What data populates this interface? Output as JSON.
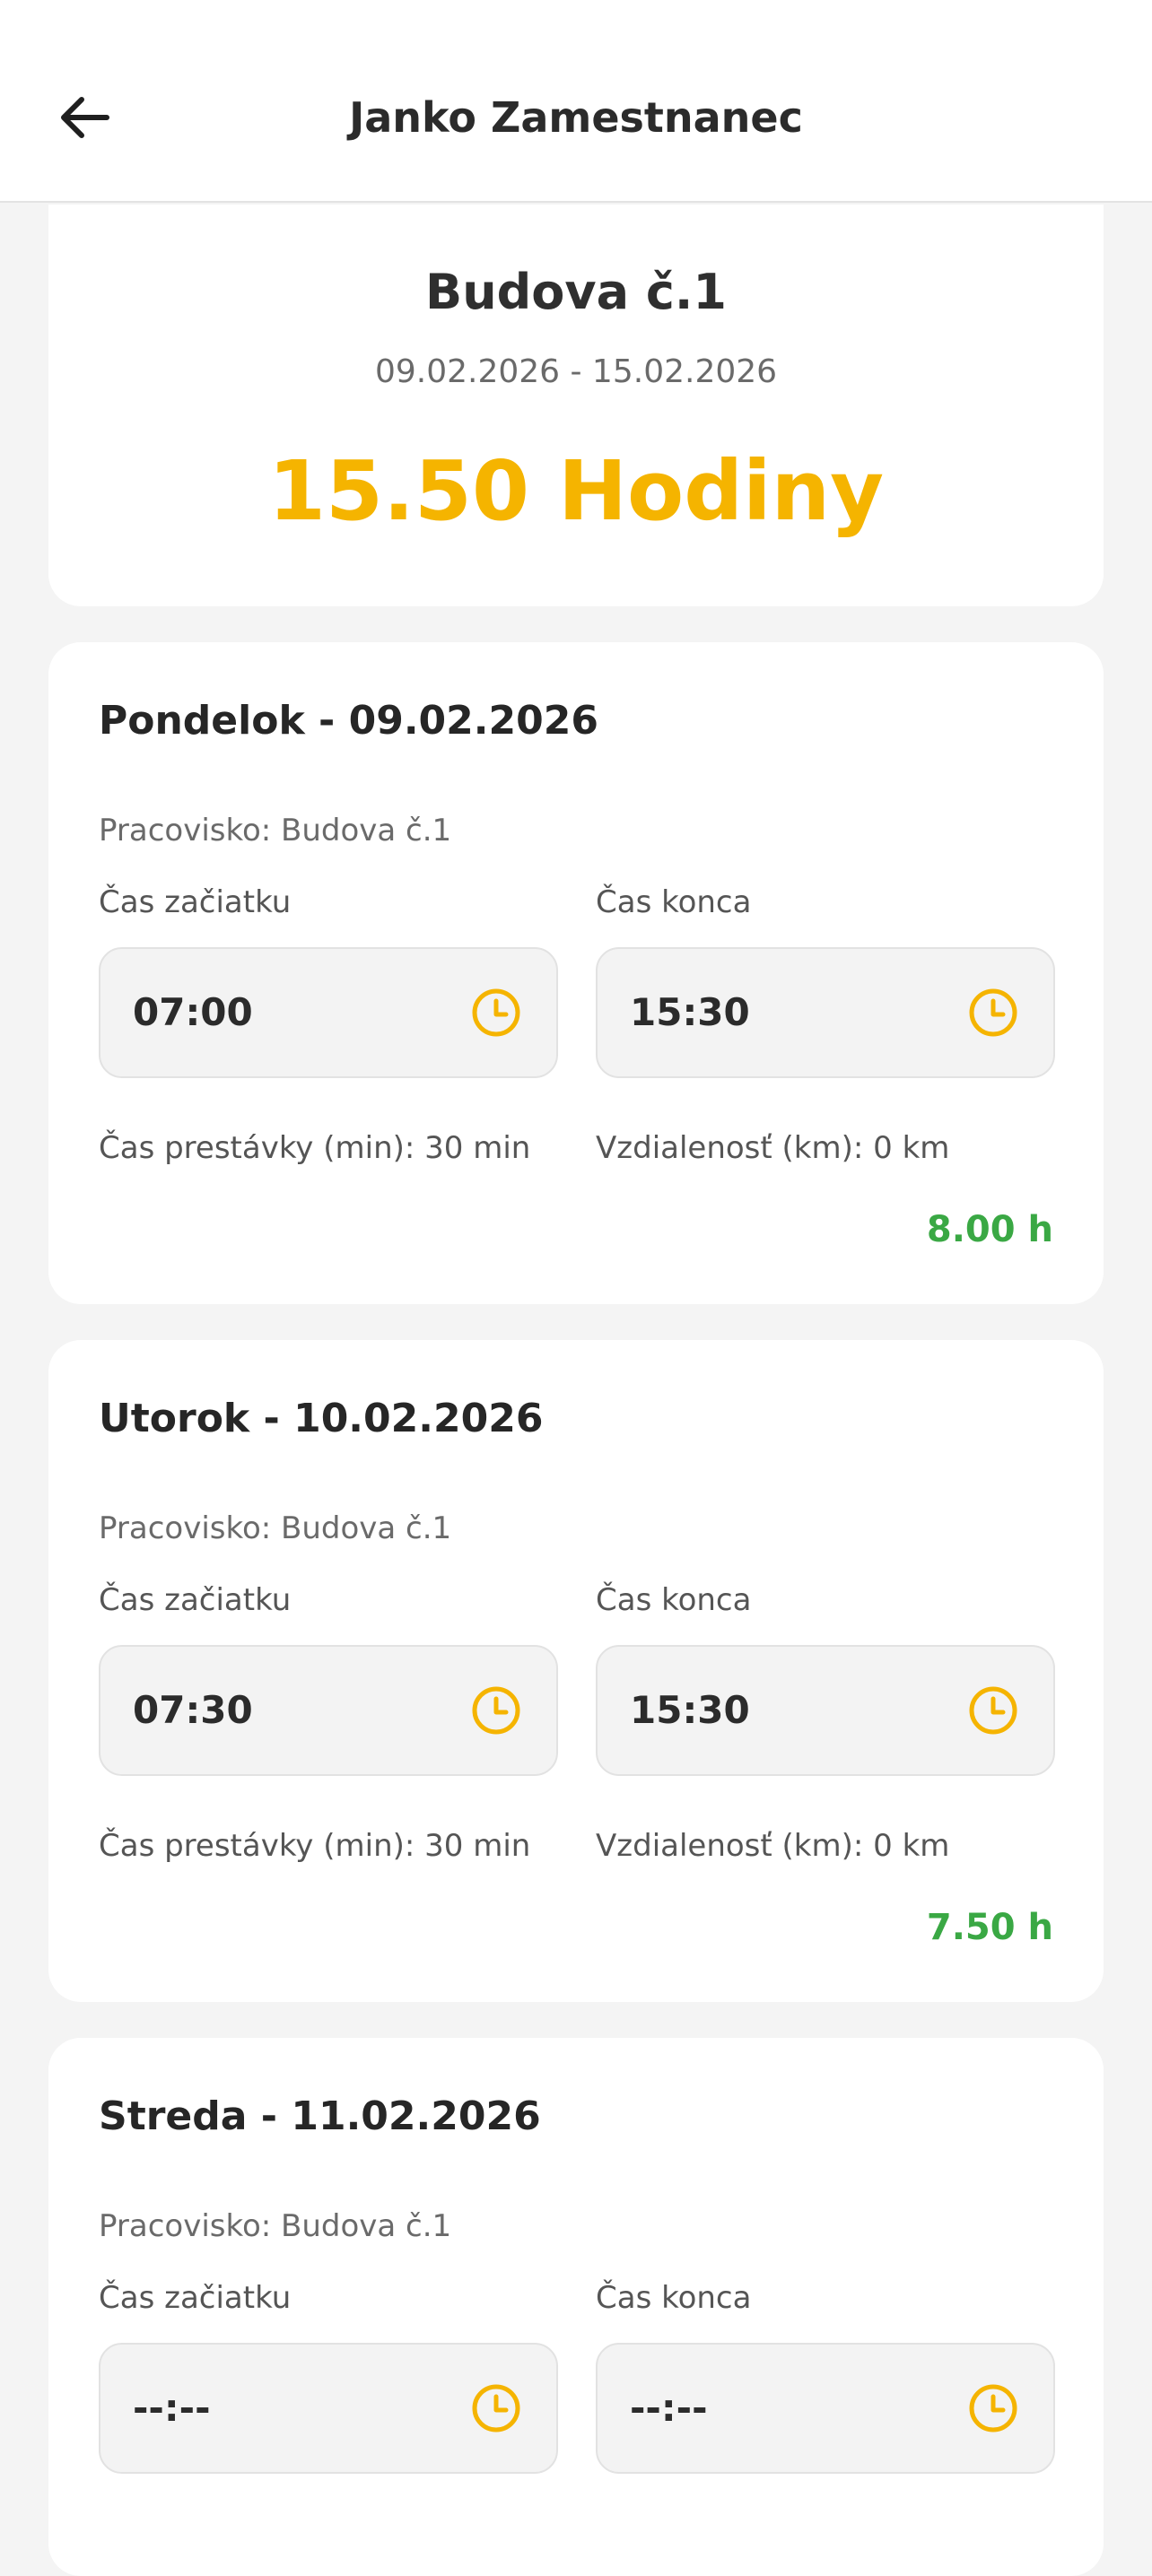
{
  "header": {
    "title": "Janko Zamestnanec"
  },
  "summary": {
    "site": "Budova č.1",
    "range": "09.02.2026 - 15.02.2026",
    "total": "15.50 Hodiny"
  },
  "labels": {
    "start": "Čas začiatku",
    "end": "Čas konca"
  },
  "days": [
    {
      "title": "Pondelok - 09.02.2026",
      "workplace": "Pracovisko: Budova č.1",
      "start": "07:00",
      "end": "15:30",
      "pause": "Čas prestávky (min): 30 min",
      "distance": "Vzdialenosť (km): 0 km",
      "hours": "8.00 h"
    },
    {
      "title": "Utorok - 10.02.2026",
      "workplace": "Pracovisko: Budova č.1",
      "start": "07:30",
      "end": "15:30",
      "pause": "Čas prestávky (min): 30 min",
      "distance": "Vzdialenosť (km): 0 km",
      "hours": "7.50 h"
    },
    {
      "title": "Streda - 11.02.2026",
      "workplace": "Pracovisko: Budova č.1",
      "start": "--:--",
      "end": "--:--"
    }
  ],
  "colors": {
    "accent": "#f5b400",
    "hours_green": "#3aa844"
  },
  "icons": {
    "back": "arrow-left-icon",
    "clock": "clock-icon"
  }
}
